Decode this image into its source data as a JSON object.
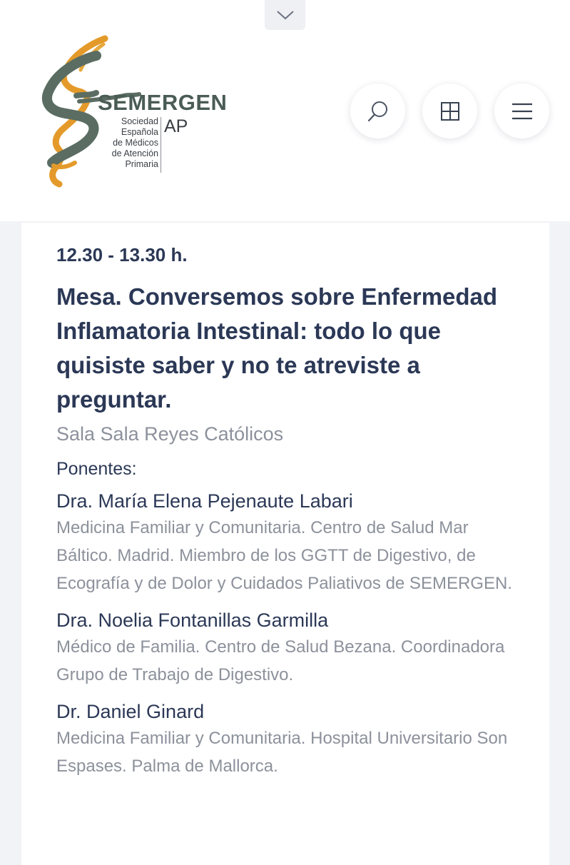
{
  "header": {
    "logo": {
      "wordmark": "SEMERGEN",
      "subtitle_lines": [
        "Sociedad",
        "Española",
        "de Médicos",
        "de Atención",
        "Primaria"
      ],
      "suffix": "AP",
      "colors": {
        "green": "#5b6d62",
        "orange": "#e49a2a",
        "text": "#4a5c55"
      }
    },
    "buttons": {
      "collapse_icon": "chevron-down-icon",
      "search_icon": "search-icon",
      "grid_icon": "grid-icon",
      "menu_icon": "hamburger-menu-icon"
    }
  },
  "session": {
    "time": "12.30 - 13.30 h.",
    "title": "Mesa. Conversemos sobre Enfermedad Inflamatoria Intestinal: todo lo que quisiste saber y no te atreviste a preguntar.",
    "room": "Sala Sala Reyes Católicos",
    "speakers_label": "Ponentes:",
    "speakers": [
      {
        "name": "Dra. María Elena Pejenaute Labari",
        "description": "Medicina Familiar y Comunitaria. Centro de Salud Mar Báltico. Madrid. Miembro de los GGTT de Digestivo, de Ecografía y de Dolor y Cuidados Paliativos de SEMERGEN."
      },
      {
        "name": "Dra. Noelia Fontanillas Garmilla",
        "description": "Médico de Familia. Centro de Salud Bezana. Coordinadora Grupo de Trabajo de Digestivo."
      },
      {
        "name": "Dr. Daniel Ginard",
        "description": "Medicina Familiar y Comunitaria. Hospital Universitario Son Espases. Palma de Mallorca."
      }
    ]
  },
  "colors": {
    "heading": "#2b3856",
    "muted": "#8c919b",
    "background": "#f2f3f6"
  }
}
